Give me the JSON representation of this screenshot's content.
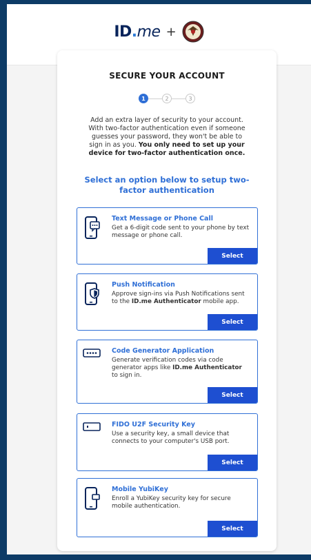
{
  "brand": {
    "logo_id": "ID",
    "logo_dot": ".",
    "logo_me": "me",
    "plus": "+"
  },
  "card": {
    "title": "SECURE YOUR ACCOUNT",
    "steps": [
      "1",
      "2",
      "3"
    ],
    "intro_plain": "Add an extra layer of security to your account. With two-factor authentication even if someone guesses your password, they won't be able to sign in as you.",
    "intro_bold": "You only need to set up your device for two-factor authentication once.",
    "subhead": "Select an option below to setup two-factor authentication"
  },
  "options": [
    {
      "title": "Text Message or Phone Call",
      "desc": "Get a 6-digit code sent to your phone by text message or phone call.",
      "button": "Select",
      "icon": "phone-message-icon"
    },
    {
      "title": "Push Notification",
      "desc_pre": "Approve sign-ins via Push Notifications sent to the ",
      "desc_bold": "ID.me Authenticator",
      "desc_post": " mobile app.",
      "button": "Select",
      "icon": "phone-shield-icon"
    },
    {
      "title": "Code Generator Application",
      "desc_pre": "Generate verification codes via code generator apps like ",
      "desc_bold": "ID.me Authenticator",
      "desc_post": " to sign in.",
      "button": "Select",
      "icon": "code-generator-icon"
    },
    {
      "title": "FIDO U2F Security Key",
      "desc": "Use a security key, a small device that connects to your computer's USB port.",
      "button": "Select",
      "icon": "security-key-icon"
    },
    {
      "title": "Mobile YubiKey",
      "desc": "Enroll a YubiKey security key for secure mobile authentication.",
      "button": "Select",
      "icon": "mobile-yubikey-icon"
    }
  ],
  "colors": {
    "accent": "#2f6fd6",
    "button": "#1e4fd1",
    "navy": "#08245b",
    "frame": "#0d3b66"
  }
}
